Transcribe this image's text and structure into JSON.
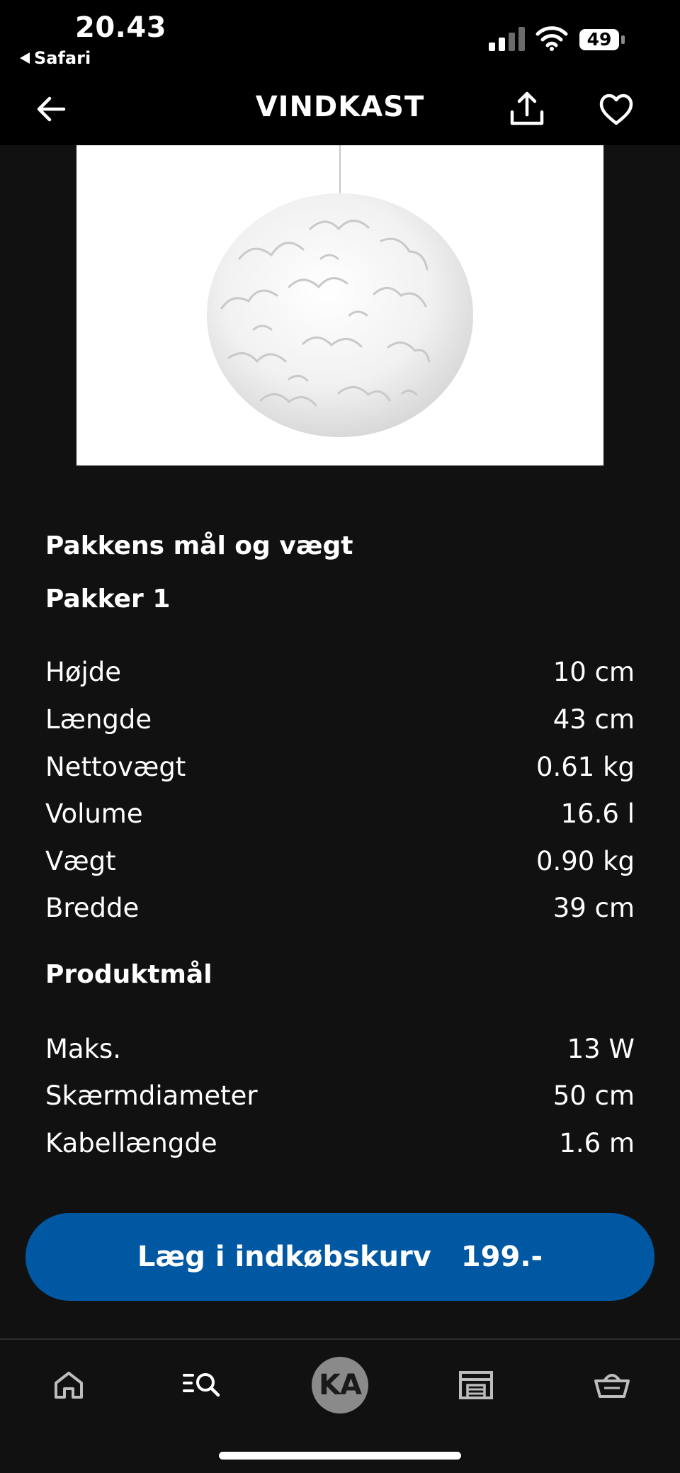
{
  "status_bar": {
    "time": "20.43",
    "back_label": "Safari",
    "battery": "49"
  },
  "header": {
    "title": "VINDKAST",
    "back_icon": "arrow-left-icon",
    "share_icon": "share-icon",
    "favorite_icon": "heart-icon"
  },
  "product": {
    "image_alt": "white ruffled pendant lamp shade"
  },
  "package": {
    "heading": "Pakkens mål og vægt",
    "subheading": "Pakker 1",
    "rows": [
      {
        "label": "Højde",
        "value": "10 cm"
      },
      {
        "label": "Længde",
        "value": "43 cm"
      },
      {
        "label": "Nettovægt",
        "value": "0.61 kg"
      },
      {
        "label": "Volume",
        "value": "16.6 l"
      },
      {
        "label": "Vægt",
        "value": "0.90 kg"
      },
      {
        "label": "Bredde",
        "value": "39 cm"
      }
    ]
  },
  "product_dimensions": {
    "heading": "Produktmål",
    "rows": [
      {
        "label": "Maks.",
        "value": "13 W"
      },
      {
        "label": "Skærmdiameter",
        "value": "50 cm"
      },
      {
        "label": "Kabellængde",
        "value": "1.6 m"
      }
    ]
  },
  "cta": {
    "label": "Læg i indkøbskurv",
    "price": "199.-"
  },
  "tabbar": {
    "items": [
      {
        "icon": "home-icon"
      },
      {
        "icon": "search-list-icon"
      },
      {
        "avatar_initials": "KA"
      },
      {
        "icon": "store-icon"
      },
      {
        "icon": "basket-icon"
      }
    ]
  },
  "colors": {
    "background": "#111111",
    "header": "#000000",
    "accent": "#0058a3",
    "text": "#ffffff"
  }
}
